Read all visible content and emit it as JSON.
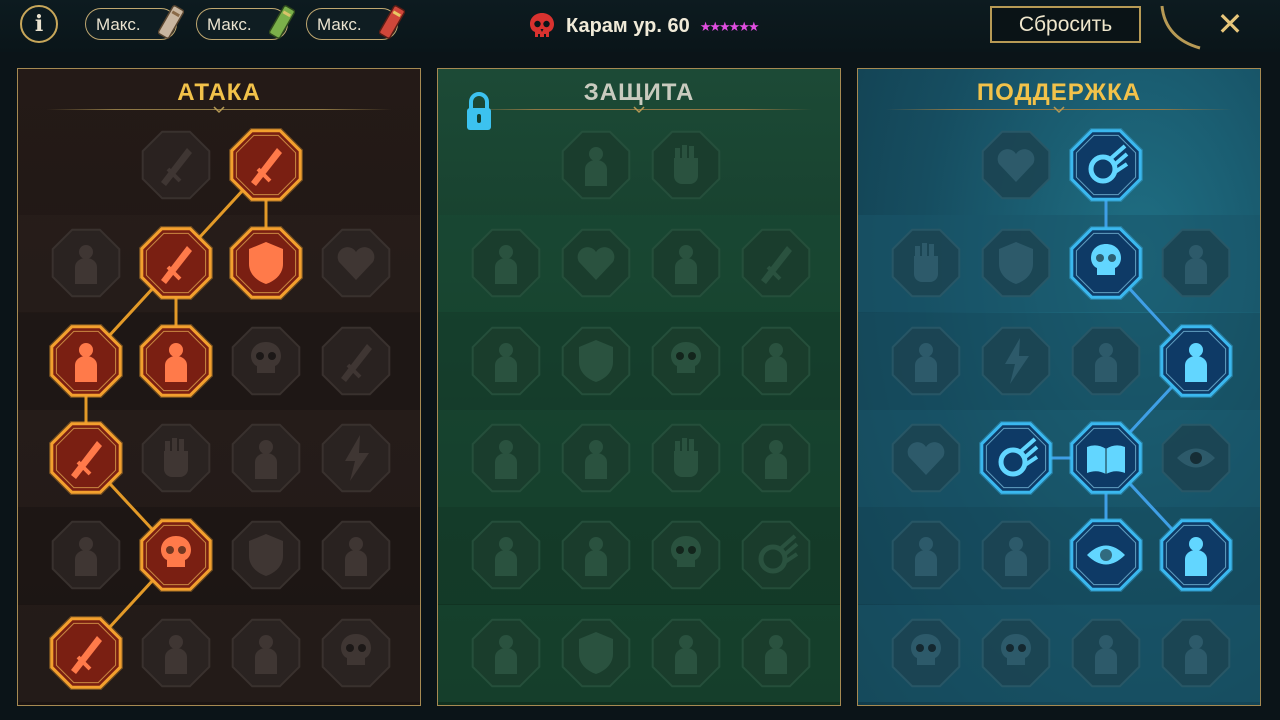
{
  "topbar": {
    "info_label": "i",
    "max_buttons": [
      {
        "label": "Макс.",
        "book_color": "#c9b6a0"
      },
      {
        "label": "Макс.",
        "book_color": "#7bb04a"
      },
      {
        "label": "Макс.",
        "book_color": "#d0473a"
      }
    ],
    "hero_name": "Карам ур. 60",
    "hero_icon": "skull-icon",
    "stars": "★★★★★★",
    "reset_label": "Сбросить",
    "close_label": "✕"
  },
  "colors": {
    "attack_active": "#e8792a",
    "support_active": "#34b6e6",
    "gold": "#d8b866"
  },
  "panels": [
    {
      "title": "АТАКА",
      "theme": "attack",
      "locked": false,
      "rows": [
        {
          "nodes": [
            {
              "icon": "crossed-swords-icon",
              "active": false
            },
            {
              "icon": "sword-slash-icon",
              "active": true
            }
          ]
        },
        {
          "nodes": [
            {
              "icon": "horned-demon-icon",
              "active": false
            },
            {
              "icon": "spear-burst-icon",
              "active": true
            },
            {
              "icon": "shield-break-icon",
              "active": true
            },
            {
              "icon": "cursed-heart-icon",
              "active": false
            }
          ]
        },
        {
          "nodes": [
            {
              "icon": "arrow-hit-icon",
              "active": true
            },
            {
              "icon": "fanged-mouth-icon",
              "active": true
            },
            {
              "icon": "hooded-skull-icon",
              "active": false
            },
            {
              "icon": "dagger-hand-icon",
              "active": false
            }
          ]
        },
        {
          "nodes": [
            {
              "icon": "bleeding-blade-icon",
              "active": true
            },
            {
              "icon": "fist-icon",
              "active": false
            },
            {
              "icon": "axe-icon",
              "active": false
            },
            {
              "icon": "lightning-chain-icon",
              "active": false
            }
          ]
        },
        {
          "nodes": [
            {
              "icon": "spider-icon",
              "active": false
            },
            {
              "icon": "triple-skull-icon",
              "active": true
            },
            {
              "icon": "shield-arc-icon",
              "active": false
            },
            {
              "icon": "warrior-icon",
              "active": false
            }
          ]
        },
        {
          "nodes": [
            {
              "icon": "sword-sparkle-icon",
              "active": true
            },
            {
              "icon": "helmet-icon",
              "active": false
            },
            {
              "icon": "demon-figure-icon",
              "active": false
            },
            {
              "icon": "spartan-skull-icon",
              "active": false
            }
          ]
        }
      ]
    },
    {
      "title": "ЗАЩИТА",
      "theme": "defense",
      "locked": true,
      "rows": [
        {
          "nodes": [
            {
              "icon": "armor-plates-icon",
              "active": false
            },
            {
              "icon": "raised-fist-icon",
              "active": false
            }
          ]
        },
        {
          "nodes": [
            {
              "icon": "cloak-icon",
              "active": false
            },
            {
              "icon": "heart-armor-icon",
              "active": false
            },
            {
              "icon": "muscle-figure-icon",
              "active": false
            },
            {
              "icon": "blade-block-icon",
              "active": false
            }
          ]
        },
        {
          "nodes": [
            {
              "icon": "dancer-icon",
              "active": false
            },
            {
              "icon": "shield-icon",
              "active": false
            },
            {
              "icon": "heart-skull-icon",
              "active": false
            },
            {
              "icon": "monk-icon",
              "active": false
            }
          ]
        },
        {
          "nodes": [
            {
              "icon": "twin-figures-icon",
              "active": false
            },
            {
              "icon": "hourglass-icon",
              "active": false
            },
            {
              "icon": "palm-icon",
              "active": false
            },
            {
              "icon": "bull-icon",
              "active": false
            }
          ]
        },
        {
          "nodes": [
            {
              "icon": "running-figure-icon",
              "active": false
            },
            {
              "icon": "drops-icon",
              "active": false
            },
            {
              "icon": "burning-skull-icon",
              "active": false
            },
            {
              "icon": "swirl-icon",
              "active": false
            }
          ]
        },
        {
          "nodes": [
            {
              "icon": "brawler-icon",
              "active": false
            },
            {
              "icon": "shield-cross-icon",
              "active": false
            },
            {
              "icon": "giant-icon",
              "active": false
            },
            {
              "icon": "titan-icon",
              "active": false
            }
          ]
        }
      ]
    },
    {
      "title": "ПОДДЕРЖКА",
      "theme": "support",
      "locked": false,
      "rows": [
        {
          "nodes": [
            {
              "icon": "heart-plus-icon",
              "active": false
            },
            {
              "icon": "vortex-icon",
              "active": true
            }
          ]
        },
        {
          "nodes": [
            {
              "icon": "praying-hands-icon",
              "active": false
            },
            {
              "icon": "energy-shield-icon",
              "active": false
            },
            {
              "icon": "flame-skull-icon",
              "active": true
            },
            {
              "icon": "speed-lines-icon",
              "active": false
            }
          ]
        },
        {
          "nodes": [
            {
              "icon": "meditating-figure-icon",
              "active": false
            },
            {
              "icon": "lightning-icon",
              "active": false
            },
            {
              "icon": "cracked-ground-icon",
              "active": false
            },
            {
              "icon": "silhouettes-icon",
              "active": true
            }
          ]
        },
        {
          "nodes": [
            {
              "icon": "chained-heart-icon",
              "active": false
            },
            {
              "icon": "comet-icon",
              "active": true
            },
            {
              "icon": "open-book-icon",
              "active": true
            },
            {
              "icon": "angry-eyes-icon",
              "active": false
            }
          ]
        },
        {
          "nodes": [
            {
              "icon": "compass-star-icon",
              "active": false
            },
            {
              "icon": "boot-icon",
              "active": false
            },
            {
              "icon": "all-seeing-eye-icon",
              "active": true
            },
            {
              "icon": "voodoo-doll-icon",
              "active": true
            }
          ]
        },
        {
          "nodes": [
            {
              "icon": "bomb-skull-icon",
              "active": false
            },
            {
              "icon": "skull-icon",
              "active": false
            },
            {
              "icon": "brute-icon",
              "active": false
            },
            {
              "icon": "eagle-icon",
              "active": false
            }
          ]
        }
      ]
    }
  ]
}
